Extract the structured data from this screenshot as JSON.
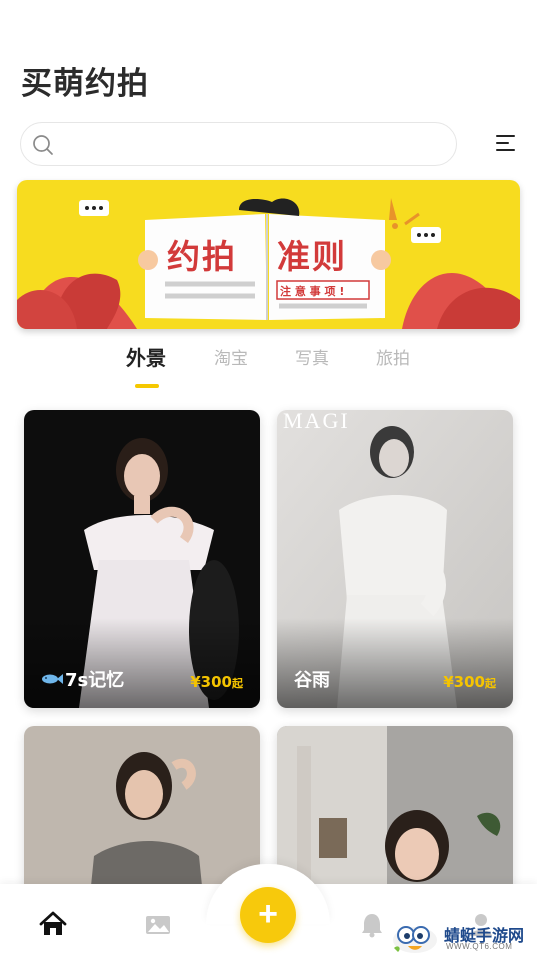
{
  "header": {
    "title": "买萌约拍"
  },
  "search": {
    "placeholder": "",
    "value": ""
  },
  "banner": {
    "left_text": "约拍",
    "right_text": "准则",
    "sub_text": "注 意 事 项 !"
  },
  "tabs": [
    {
      "label": "外景",
      "active": true
    },
    {
      "label": "淘宝",
      "active": false
    },
    {
      "label": "写真",
      "active": false
    },
    {
      "label": "旅拍",
      "active": false
    }
  ],
  "cards": [
    {
      "name": "7s记忆",
      "price": "¥300",
      "price_suffix": "起",
      "has_fish_icon": true
    },
    {
      "name": "谷雨",
      "price": "¥300",
      "price_suffix": "起",
      "photo_caption": "MAGI"
    },
    {
      "name": "",
      "price": "",
      "price_suffix": ""
    },
    {
      "name": "",
      "price": "",
      "price_suffix": ""
    }
  ],
  "bottom_nav": {
    "items": [
      {
        "icon": "home-icon"
      },
      {
        "icon": "photo-album-icon"
      },
      {
        "icon": "add-icon",
        "label": "+"
      },
      {
        "icon": "bell-icon"
      },
      {
        "icon": "profile-icon"
      }
    ]
  },
  "watermark": {
    "title": "蜻蜓手游网",
    "url": "WWW.QT6.COM"
  },
  "colors": {
    "accent": "#f7c90c",
    "price": "#f5c400",
    "banner_bg": "#f7dc1f",
    "banner_text": "#d23a3a"
  }
}
